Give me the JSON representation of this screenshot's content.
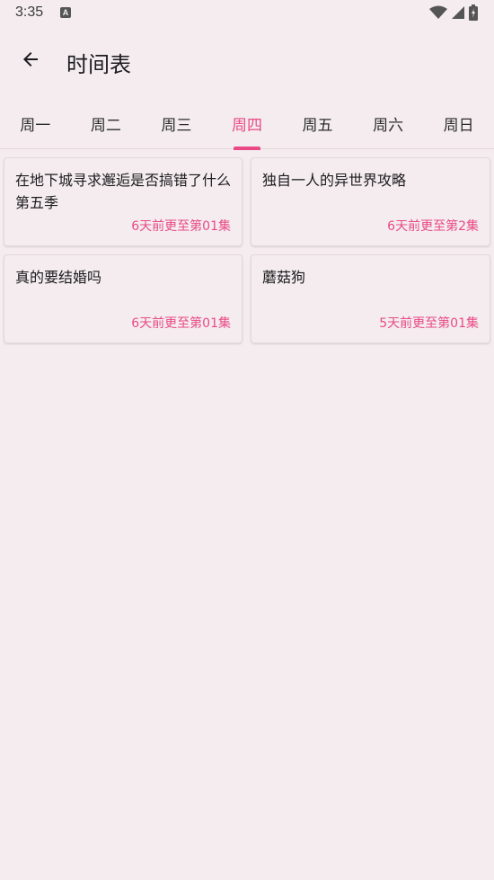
{
  "status_bar": {
    "time": "3:35",
    "notification_icon": "a-icon",
    "icons": [
      "wifi-icon",
      "signal-icon",
      "battery-icon"
    ]
  },
  "app_bar": {
    "back_icon": "arrow-left-icon",
    "title": "时间表"
  },
  "tabs": [
    {
      "label": "周一",
      "active": false
    },
    {
      "label": "周二",
      "active": false
    },
    {
      "label": "周三",
      "active": false
    },
    {
      "label": "周四",
      "active": true
    },
    {
      "label": "周五",
      "active": false
    },
    {
      "label": "周六",
      "active": false
    },
    {
      "label": "周日",
      "active": false
    }
  ],
  "cards": [
    {
      "title": "在地下城寻求邂逅是否搞错了什么第五季",
      "meta": "6天前更至第01集"
    },
    {
      "title": "独自一人的异世界攻略",
      "meta": "6天前更至第2集"
    },
    {
      "title": "真的要结婚吗",
      "meta": "6天前更至第01集"
    },
    {
      "title": "蘑菇狗",
      "meta": "5天前更至第01集"
    }
  ],
  "colors": {
    "accent": "#e94a86",
    "background": "#f4ecee"
  }
}
